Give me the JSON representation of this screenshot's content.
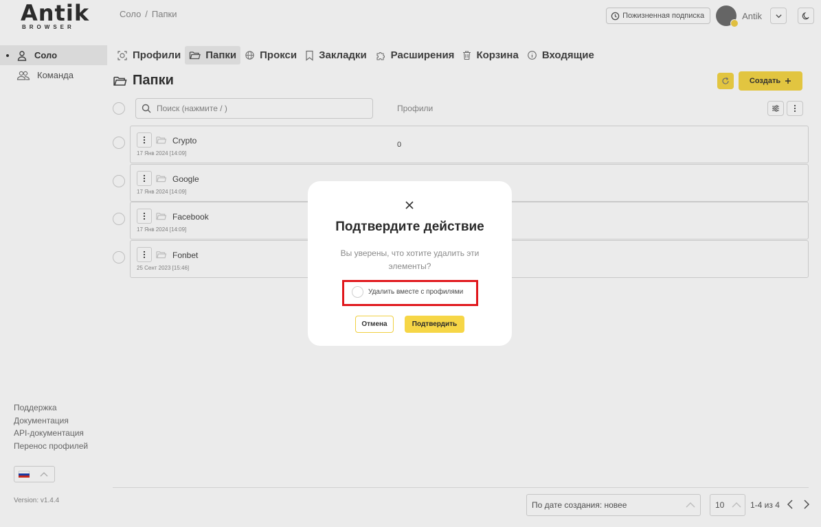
{
  "app": {
    "logo_text": "Antik",
    "logo_sub": "BROWSER"
  },
  "breadcrumb": {
    "items": [
      "Соло",
      "Папки"
    ],
    "separator": "/"
  },
  "header": {
    "subscription_label": "Пожизненная подписка",
    "username": "Antik"
  },
  "sidebar": {
    "items": [
      {
        "label": "Соло",
        "icon": "user-icon",
        "active": true
      },
      {
        "label": "Команда",
        "icon": "team-icon",
        "active": false
      }
    ],
    "links": [
      "Поддержка",
      "Документация",
      "API-документация",
      "Перенос профилей"
    ],
    "version": "Version: v1.4.4"
  },
  "tabs": [
    {
      "label": "Профили",
      "icon": "fingerprint-icon"
    },
    {
      "label": "Папки",
      "icon": "folder-icon",
      "active": true
    },
    {
      "label": "Прокси",
      "icon": "globe-icon"
    },
    {
      "label": "Закладки",
      "icon": "bookmark-icon"
    },
    {
      "label": "Расширения",
      "icon": "puzzle-icon"
    },
    {
      "label": "Корзина",
      "icon": "trash-icon"
    },
    {
      "label": "Входящие",
      "icon": "info-icon"
    }
  ],
  "page": {
    "title": "Папки",
    "create_label": "Создать",
    "search_placeholder": "Поиск (нажмите / )",
    "column_profiles": "Профили"
  },
  "folders": [
    {
      "name": "Crypto",
      "date": "17 Янв 2024 [14:09]",
      "profiles": "0"
    },
    {
      "name": "Google",
      "date": "17 Янв 2024 [14:09]",
      "profiles": ""
    },
    {
      "name": "Facebook",
      "date": "17 Янв 2024 [14:09]",
      "profiles": ""
    },
    {
      "name": "Fonbet",
      "date": "25 Сент 2023 [15:46]",
      "profiles": ""
    }
  ],
  "footer": {
    "sort_value": "По дате создания: новее",
    "per_page": "10",
    "range": "1-4 из 4"
  },
  "modal": {
    "title": "Подтвердите действие",
    "message": "Вы уверены, что хотите удалить эти элементы?",
    "option_label": "Удалить вместе с профилями",
    "cancel_label": "Отмена",
    "confirm_label": "Подтвердить"
  },
  "colors": {
    "accent": "#f6d646",
    "highlight": "#e0161b"
  }
}
